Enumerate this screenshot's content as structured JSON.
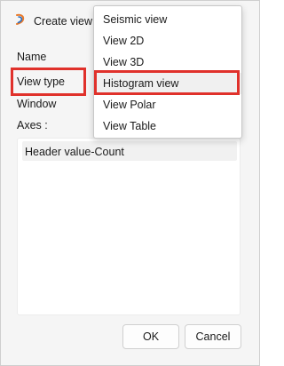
{
  "dialog": {
    "title": "Create view",
    "labels": {
      "name": "Name",
      "view_type": "View type",
      "window": "Window",
      "axes": "Axes :"
    },
    "axes_items": [
      "Header value-Count"
    ],
    "buttons": {
      "ok": "OK",
      "cancel": "Cancel"
    }
  },
  "view_type_dropdown": {
    "options": [
      "Seismic view",
      "View 2D",
      "View 3D",
      "Histogram view",
      "View Polar",
      "View Table"
    ],
    "selected": "Histogram view"
  },
  "colors": {
    "highlight": "#e0312b",
    "dialog_bg": "#f5f5f5"
  }
}
